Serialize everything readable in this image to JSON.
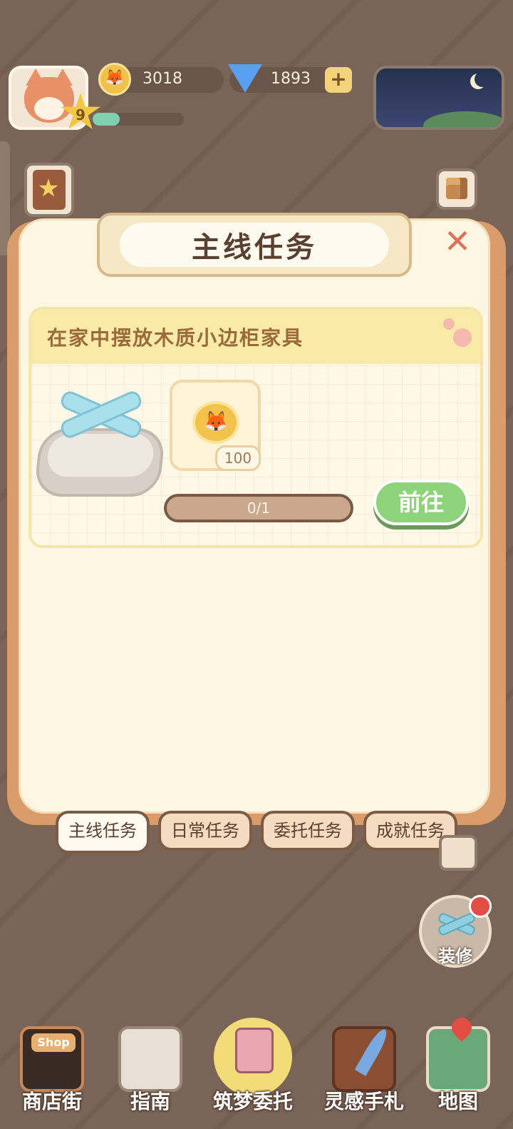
{
  "hud": {
    "level": "9",
    "xp_progress": 0.3,
    "coins": "3018",
    "gems": "1893",
    "add_label": "+"
  },
  "panel": {
    "title": "主线任务",
    "close_label": "✕"
  },
  "task": {
    "description": "在家中摆放木质小边柜家具",
    "reward_count": "100",
    "progress_text": "0/1",
    "go_label": "前往"
  },
  "tabs": [
    {
      "label": "主线任务",
      "active": true
    },
    {
      "label": "日常任务",
      "active": false
    },
    {
      "label": "委托任务",
      "active": false
    },
    {
      "label": "成就任务",
      "active": false
    }
  ],
  "renovate": {
    "label": "装修"
  },
  "bottom_nav": [
    {
      "label": "商店街",
      "icon": "shop-icon",
      "sign": "Shop"
    },
    {
      "label": "指南",
      "icon": "guide-icon"
    },
    {
      "label": "筑梦委托",
      "icon": "notebook-icon"
    },
    {
      "label": "灵感手札",
      "icon": "quill-book-icon"
    },
    {
      "label": "地图",
      "icon": "map-icon"
    }
  ],
  "colors": {
    "background": "#7a6458",
    "panel": "#fdf6e3",
    "accent_green": "#8ed27a",
    "close_red": "#d9745a"
  }
}
